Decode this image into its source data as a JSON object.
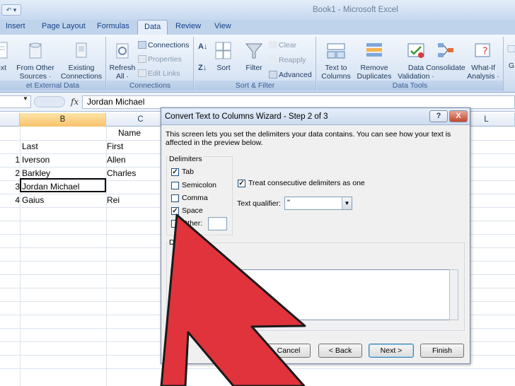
{
  "window": {
    "title": "Book1 - Microsoft Excel",
    "qat_label": "↶ ▾"
  },
  "ribbon": {
    "tabs": [
      "Insert",
      "Page Layout",
      "Formulas",
      "Data",
      "Review",
      "View"
    ],
    "active_tab": "Data",
    "groups": {
      "get_external": {
        "label": "et External Data",
        "text_btn": "ext",
        "other_sources": [
          "From Other",
          "Sources ·"
        ],
        "existing": [
          "Existing",
          "Connections"
        ]
      },
      "connections": {
        "label": "Connections",
        "refresh": [
          "Refresh",
          "All ·"
        ],
        "items": [
          "Connections",
          "Properties",
          "Edit Links"
        ]
      },
      "sort_filter": {
        "label": "Sort & Filter",
        "sort": "Sort",
        "filter": "Filter",
        "items": [
          "Clear",
          "Reapply",
          "Advanced"
        ]
      },
      "data_tools": {
        "label": "Data Tools",
        "buttons": [
          [
            "Text to",
            "Columns"
          ],
          [
            "Remove",
            "Duplicates"
          ],
          [
            "Data",
            "Validation ·"
          ],
          [
            "Consolidate",
            ""
          ],
          [
            "What-If",
            "Analysis ·"
          ]
        ],
        "overflow": [
          "G"
        ]
      }
    }
  },
  "formula_bar": {
    "fx": "fx",
    "content": "Jordan Michael"
  },
  "grid": {
    "columns": [
      "B",
      "C",
      "L"
    ],
    "selected_column": "B",
    "rows": [
      {
        "b": "",
        "c": "Name"
      },
      {
        "b": "Last",
        "c": "First"
      },
      {
        "num": "1",
        "b": "Iverson",
        "c": "Allen"
      },
      {
        "num": "2",
        "b": "Barkley",
        "c": "Charles"
      },
      {
        "num": "3",
        "b": "Jordan Michael",
        "c": ""
      },
      {
        "num": "4",
        "b": "Gaius",
        "c": "Rei"
      }
    ]
  },
  "dialog": {
    "title": "Convert Text to Columns Wizard - Step 2 of 3",
    "help": "?",
    "close": "X",
    "description": "This screen lets you set the delimiters your data contains.  You can see how your text is affected in the preview below.",
    "delimiters_label": "Delimiters",
    "delimiters": [
      {
        "label": "Tab",
        "checked": true
      },
      {
        "label": "Semicolon",
        "checked": false
      },
      {
        "label": "Comma",
        "checked": false
      },
      {
        "label": "Space",
        "checked": true
      },
      {
        "label": "Other:",
        "checked": false
      }
    ],
    "check_mark": "✓",
    "treat_consecutive": "Treat consecutive delimiters as one",
    "text_qualifier_label": "Text qualifier:",
    "text_qualifier_value": "\"",
    "preview_label": "Da",
    "preview_line": "J",
    "buttons": {
      "cancel": "Cancel",
      "back": "< Back",
      "next": "Next >",
      "finish": "Finish"
    }
  },
  "colors": {
    "arrow_fill": "#e0333c",
    "arrow_stroke": "#1a1a1a",
    "selected_header": "#f7c26b"
  }
}
